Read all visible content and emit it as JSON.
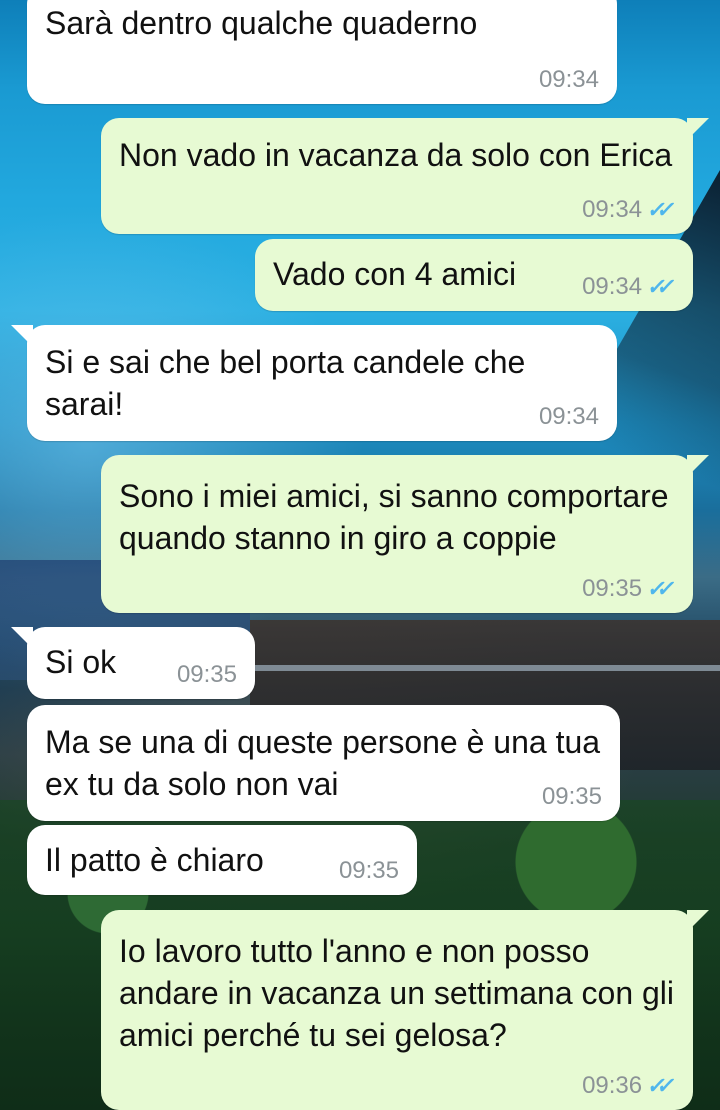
{
  "chat": {
    "messages": [
      {
        "direction": "in",
        "text": "Sarà dentro qualche quaderno",
        "time": "09:34"
      },
      {
        "direction": "out",
        "text": "Non vado in vacanza da solo con Erica",
        "time": "09:34",
        "status": "read"
      },
      {
        "direction": "out",
        "text": "Vado con 4 amici",
        "time": "09:34",
        "status": "read"
      },
      {
        "direction": "in",
        "text": "Si e sai che bel porta candele che sarai!",
        "time": "09:34"
      },
      {
        "direction": "out",
        "text": "Sono i miei amici, si sanno comportare quando stanno in giro a coppie",
        "time": "09:35",
        "status": "read"
      },
      {
        "direction": "in",
        "text": "Si ok",
        "time": "09:35"
      },
      {
        "direction": "in",
        "text": "Ma se una di queste persone è una tua ex tu da solo non vai",
        "time": "09:35"
      },
      {
        "direction": "in",
        "text": "Il patto è chiaro",
        "time": "09:35"
      },
      {
        "direction": "out",
        "text": "Io lavoro tutto l'anno e non posso andare in vacanza un settimana con gli amici perché tu sei gelosa?",
        "time": "09:36",
        "status": "read"
      }
    ]
  },
  "icons": {
    "read_receipt": "double-check-icon"
  },
  "colors": {
    "incoming_bubble": "#ffffff",
    "outgoing_bubble": "#e7fad3",
    "timestamp": "#8b9296",
    "read_receipt": "#4fb6ec"
  }
}
